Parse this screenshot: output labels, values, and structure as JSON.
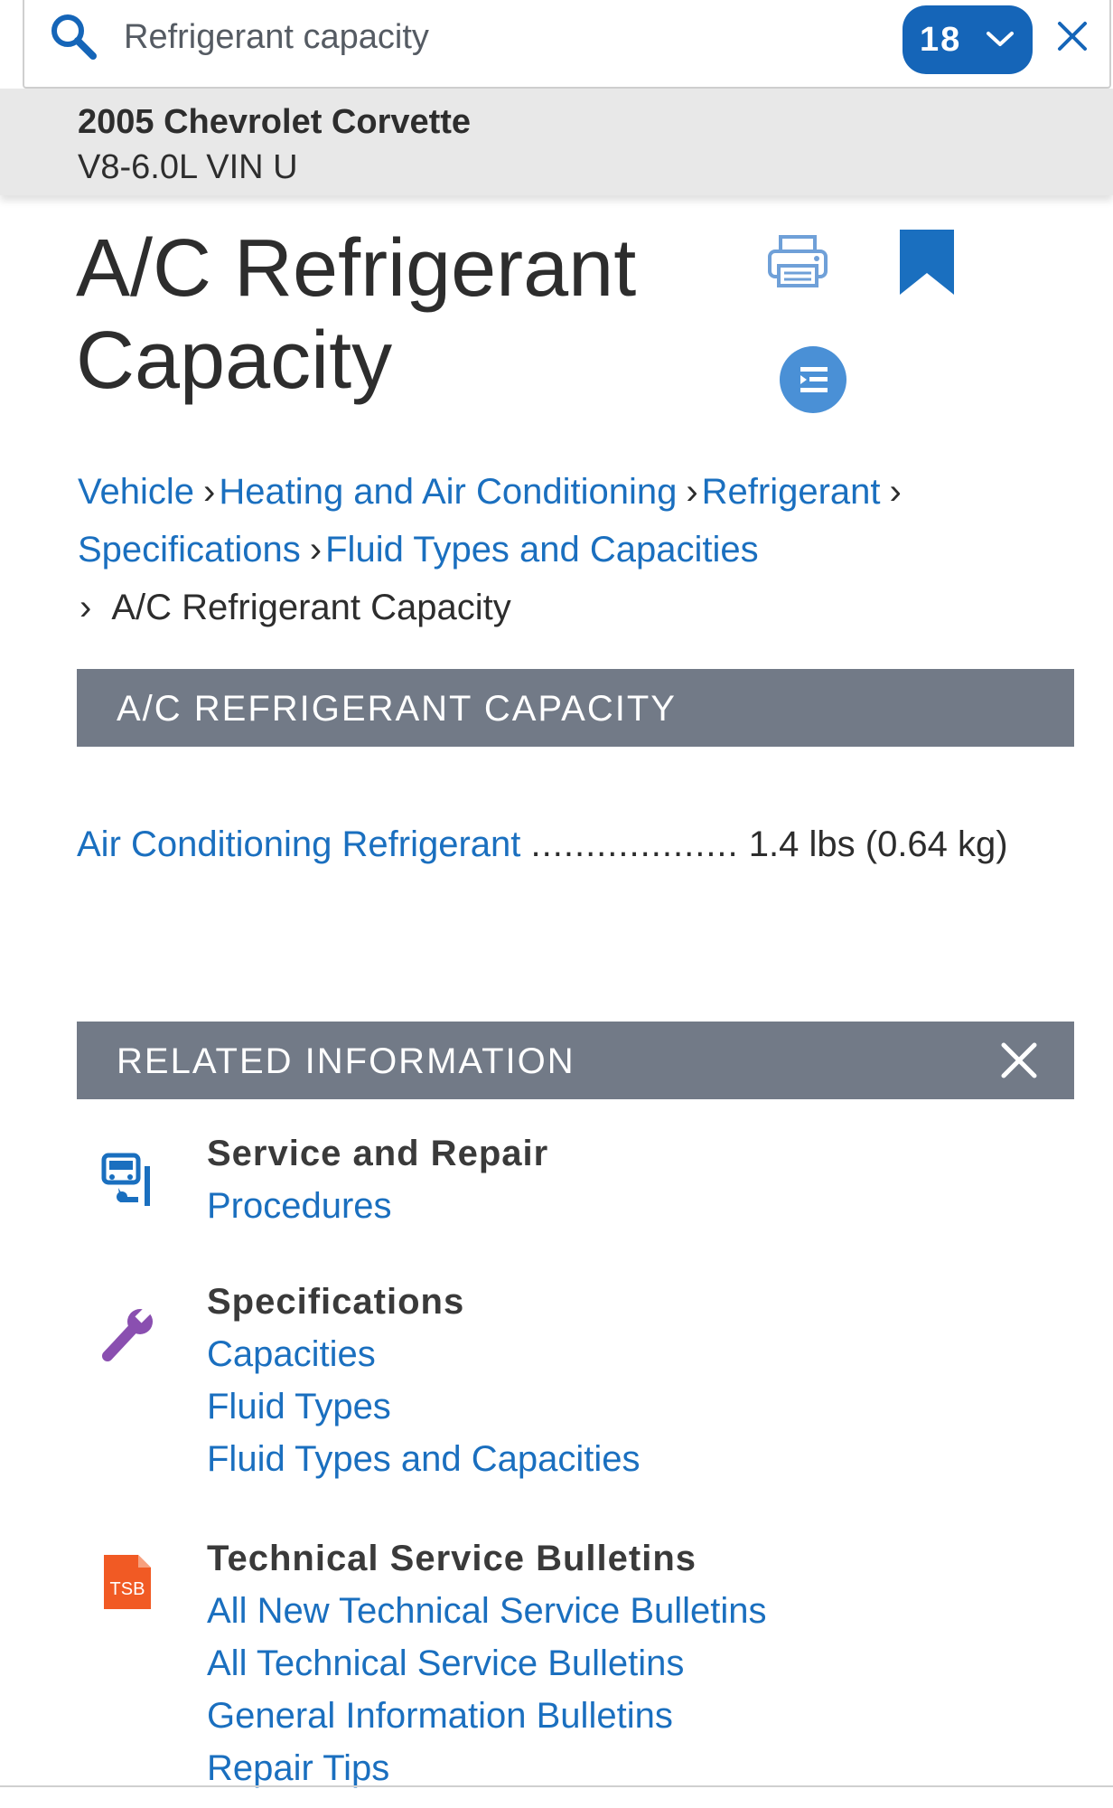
{
  "search": {
    "value": "Refrigerant capacity",
    "count": "18"
  },
  "vehicle": {
    "name": "2005 Chevrolet Corvette",
    "engine": "V8-6.0L VIN U"
  },
  "page": {
    "title_line1": "A/C Refrigerant",
    "title_line2": "Capacity"
  },
  "breadcrumb": {
    "items": [
      "Vehicle",
      "Heating and Air Conditioning",
      "Refrigerant",
      "Specifications",
      "Fluid Types and Capacities"
    ],
    "current": "A/C Refrigerant Capacity"
  },
  "capacity_section": {
    "header": "A/C REFRIGERANT CAPACITY",
    "label": "Air Conditioning Refrigerant",
    "dots": "...................",
    "value": "1.4 lbs (0.64 kg)"
  },
  "related": {
    "header": "RELATED INFORMATION",
    "groups": [
      {
        "heading": "Service and Repair",
        "icon": "service-repair-icon",
        "links": [
          "Procedures"
        ]
      },
      {
        "heading": "Specifications",
        "icon": "wrench-icon",
        "links": [
          "Capacities",
          "Fluid Types",
          "Fluid Types and Capacities"
        ]
      },
      {
        "heading": "Technical Service Bulletins",
        "icon": "tsb-icon",
        "icon_text": "TSB",
        "links": [
          "All New Technical Service Bulletins",
          "All Technical Service Bulletins",
          "General Information Bulletins",
          "Repair Tips"
        ]
      }
    ]
  },
  "colors": {
    "link": "#1a6fbf",
    "accent": "#1565b8",
    "header_bar": "#727a87",
    "tsb": "#f15a24",
    "wrench": "#8a4fb0"
  }
}
